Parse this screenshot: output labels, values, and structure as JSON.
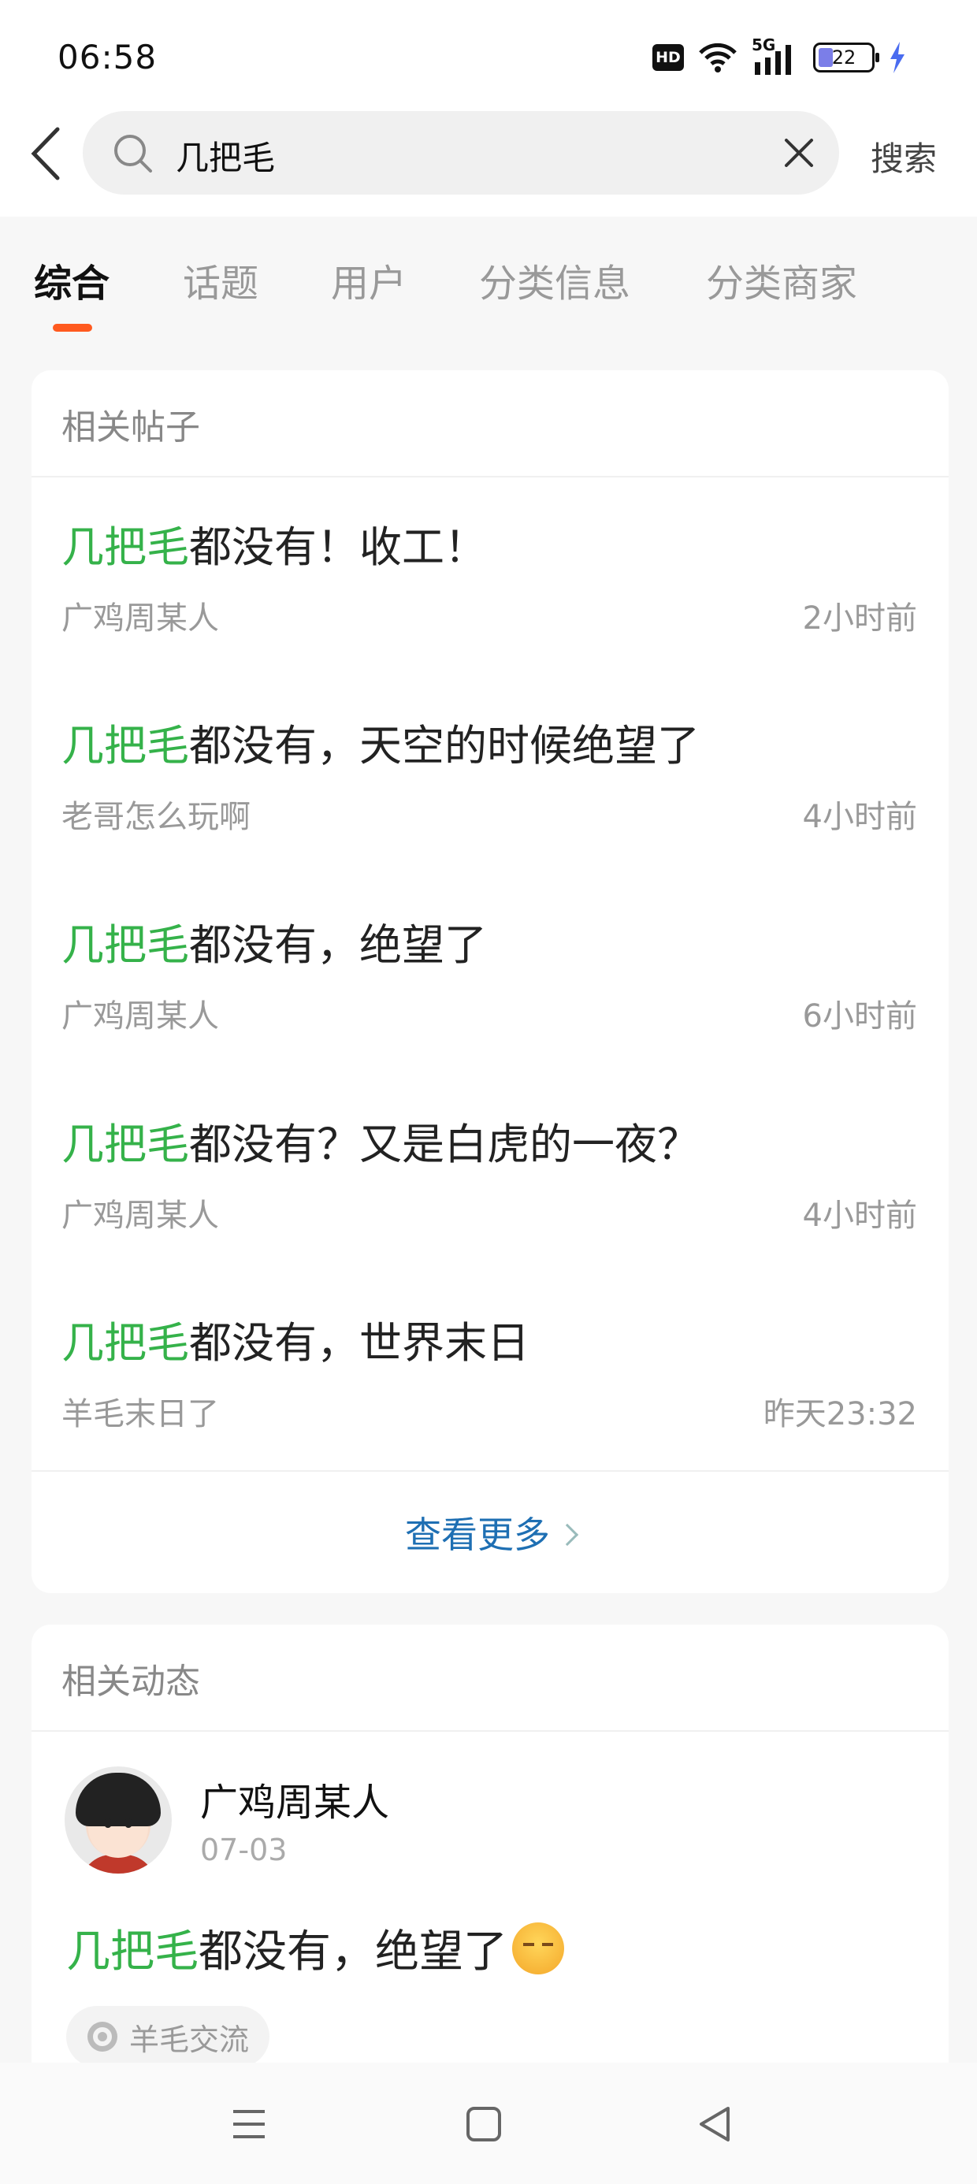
{
  "status_bar": {
    "time": "06:58",
    "network": "5G",
    "hd_label": "HD",
    "battery_level": "22",
    "battery_color": "#7b7ee8",
    "charging_color": "#4a6cf0"
  },
  "search": {
    "query": "几把毛",
    "search_button": "搜索"
  },
  "tabs": [
    {
      "label": "综合",
      "active": true
    },
    {
      "label": "话题",
      "active": false
    },
    {
      "label": "用户",
      "active": false
    },
    {
      "label": "分类信息",
      "active": false
    },
    {
      "label": "分类商家",
      "active": false
    }
  ],
  "colors": {
    "accent": "#ff5a1f",
    "highlight": "#35b24a",
    "link": "#1e6fb3"
  },
  "posts_section": {
    "title": "相关帖子",
    "posts": [
      {
        "highlight": "几把毛",
        "rest": "都没有！收工！",
        "author": "广鸡周某人",
        "time": "2小时前"
      },
      {
        "highlight": "几把毛",
        "rest": "都没有，天空的时候绝望了",
        "author": "老哥怎么玩啊",
        "time": "4小时前"
      },
      {
        "highlight": "几把毛",
        "rest": "都没有，绝望了",
        "author": "广鸡周某人",
        "time": "6小时前"
      },
      {
        "highlight": "几把毛",
        "rest": "都没有？又是白虎的一夜？",
        "author": "广鸡周某人",
        "time": "4小时前"
      },
      {
        "highlight": "几把毛",
        "rest": "都没有，世界末日",
        "author": "羊毛末日了",
        "time": "昨天23:32"
      }
    ],
    "more_label": "查看更多"
  },
  "feed_section": {
    "title": "相关动态",
    "item": {
      "user": "广鸡周某人",
      "date": "07-03",
      "highlight": "几把毛",
      "rest": "都没有，绝望了",
      "emoji": "exasperated-face-emoji",
      "topic": "羊毛交流"
    }
  },
  "nav_bar": {
    "icons": [
      "menu-icon",
      "home-square-icon",
      "back-triangle-icon"
    ]
  }
}
